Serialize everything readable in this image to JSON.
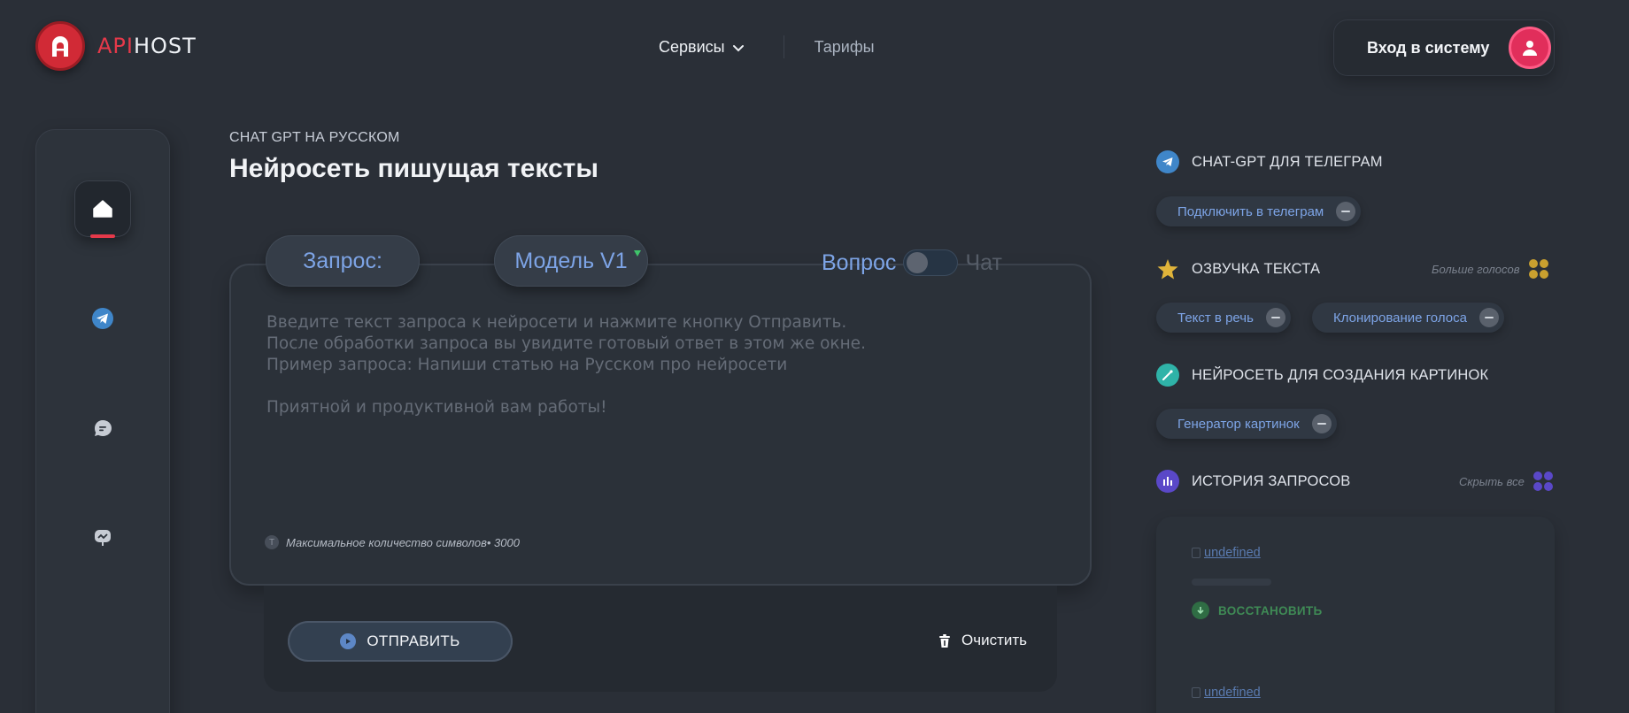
{
  "brand": {
    "api": "API",
    "host": "HOST"
  },
  "nav": {
    "services": "Сервисы",
    "tariffs": "Тарифы"
  },
  "login": {
    "label": "Вход в систему"
  },
  "sidebar": {
    "items": [
      "home-icon",
      "telegram-icon",
      "chat-icon",
      "image-icon"
    ],
    "active": "home"
  },
  "main": {
    "eyebrow": "CHAT GPT НА РУССКОМ",
    "title": "Нейросеть пишущая тексты",
    "tabs": {
      "request": "Запрос:",
      "model": "Модель V1"
    },
    "mode": {
      "question": "Вопрос",
      "chat": "Чат",
      "selected": "Вопрос"
    },
    "placeholder": "Введите текст запроса к нейросети и нажмите кнопку Отправить.\nПосле обработки запроса вы увидите готовый ответ в этом же окне.\nПример запроса: Напиши статью на Русском про нейросети\n\nПриятной и продуктивной вам работы!",
    "max_chars": "Максимальное количество символов• 3000",
    "max_chars_badge": "T",
    "send": "ОТПРАВИТЬ",
    "clear": "Очистить"
  },
  "right": {
    "telegram": {
      "title": "CHAT-GPT ДЛЯ ТЕЛЕГРАМ",
      "chip": "Подключить в телеграм"
    },
    "tts": {
      "title": "ОЗВУЧКА ТЕКСТА",
      "more": "Больше голосов",
      "chips": [
        "Текст в речь",
        "Клонирование голоса"
      ]
    },
    "images": {
      "title": "НЕЙРОСЕТЬ ДЛЯ СОЗДАНИЯ КАРТИНОК",
      "chip": "Генератор картинок"
    },
    "history": {
      "title": "ИСТОРИЯ ЗАПРОСОВ",
      "hide": "Скрыть все",
      "items": [
        "undefined",
        "undefined"
      ],
      "restore": "ВОССТАНОВИТЬ"
    }
  },
  "colors": {
    "accent_red": "#e5394a",
    "accent_blue": "#7da4e6",
    "bg": "#2a2f37"
  }
}
